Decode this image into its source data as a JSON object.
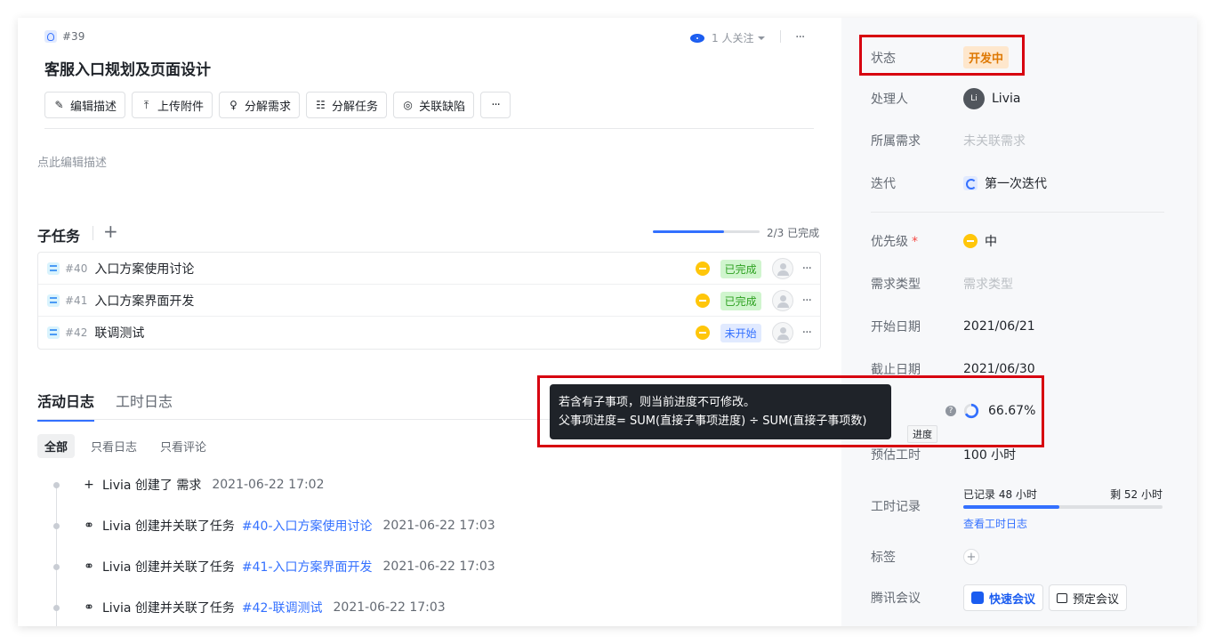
{
  "header": {
    "id": "#39",
    "title": "客服入口规划及页面设计",
    "follow_label": "1 人关注",
    "more": "···"
  },
  "toolbar": {
    "buttons": [
      {
        "label": "编辑描述",
        "icon": "pencil-icon"
      },
      {
        "label": "上传附件",
        "icon": "upload-icon"
      },
      {
        "label": "分解需求",
        "icon": "bulb-icon"
      },
      {
        "label": "分解任务",
        "icon": "task-list-icon"
      },
      {
        "label": "关联缺陷",
        "icon": "bug-icon"
      }
    ],
    "more": "···"
  },
  "description": {
    "placeholder": "点此编辑描述"
  },
  "subtasks": {
    "title": "子任务",
    "add": "+",
    "progress_text": "2/3 已完成",
    "progress": 0.6667,
    "items": [
      {
        "id": "#40",
        "name": "入口方案使用讨论",
        "status": "已完成"
      },
      {
        "id": "#41",
        "name": "入口方案界面开发",
        "status": "已完成"
      },
      {
        "id": "#42",
        "name": "联调测试",
        "status": "未开始"
      }
    ],
    "more": "···"
  },
  "activity": {
    "tabs": [
      "活动日志",
      "工时日志"
    ],
    "filters": [
      "全部",
      "只看日志",
      "只看评论"
    ],
    "logs": [
      {
        "icon": "plus-icon",
        "text": "Livia 创建了 需求",
        "link": "",
        "time": "2021-06-22 17:02"
      },
      {
        "icon": "link-icon",
        "text": "Livia 创建并关联了任务",
        "link": "#40-入口方案使用讨论",
        "time": "2021-06-22 17:03"
      },
      {
        "icon": "link-icon",
        "text": "Livia 创建并关联了任务",
        "link": "#41-入口方案界面开发",
        "time": "2021-06-22 17:03"
      },
      {
        "icon": "link-icon",
        "text": "Livia 创建并关联了任务",
        "link": "#42-联调测试",
        "time": "2021-06-22 17:03"
      }
    ]
  },
  "tooltip": {
    "line1": "若含有子事项，则当前进度不可修改。",
    "line2": "父事项进度= SUM(直接子事项进度) ÷ SUM(直接子事项数)"
  },
  "props": {
    "status_label": "状态",
    "status_value": "开发中",
    "assignee_label": "处理人",
    "assignee_initials": "Li",
    "assignee_value": "Livia",
    "parent_label": "所属需求",
    "parent_value": "未关联需求",
    "iteration_label": "迭代",
    "iteration_value": "第一次迭代",
    "priority_label": "优先级",
    "priority_required": "*",
    "priority_value": "中",
    "type_label": "需求类型",
    "type_value": "需求类型",
    "start_label": "开始日期",
    "start_value": "2021/06/21",
    "end_label": "截止日期",
    "end_value": "2021/06/30",
    "progress_tip": "进度",
    "progress_value": "66.67%",
    "progress_fraction": 0.6667,
    "estimate_label": "预估工时",
    "estimate_value": "100 小时",
    "worklog_label": "工时记录",
    "worklog_recorded": "已记录 48 小时",
    "worklog_remaining": "剩 52 小时",
    "worklog_fraction": 0.48,
    "worklog_link": "查看工时日志",
    "tags_label": "标签",
    "tags_add": "+",
    "meeting_label": "腾讯会议",
    "meeting_quick": "快速会议",
    "meeting_schedule": "预定会议"
  },
  "colors": {
    "accent": "#3370ff",
    "status_bg": "#fee7cd",
    "status_fg": "#de7802",
    "highlight": "#d7000f"
  }
}
